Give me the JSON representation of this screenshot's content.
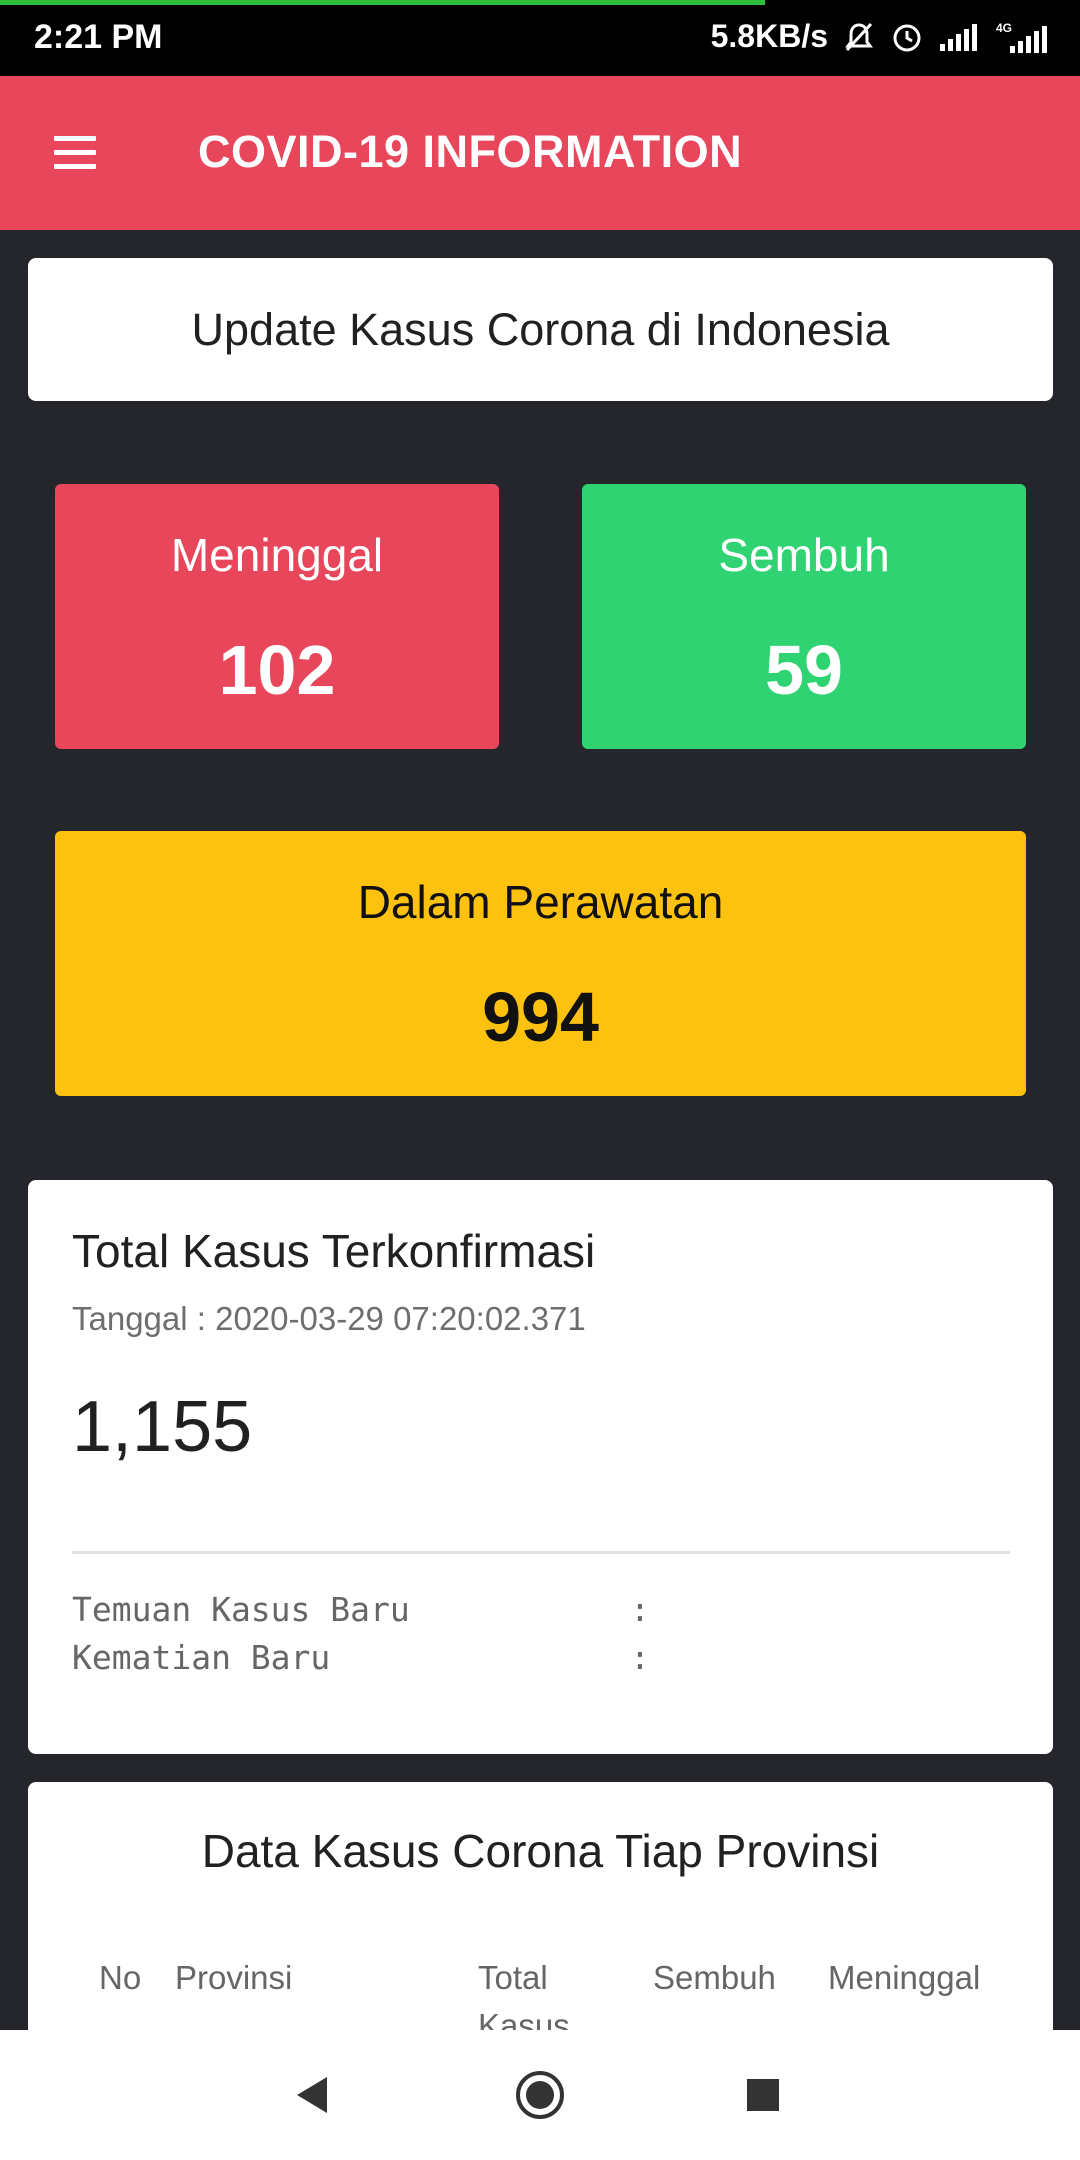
{
  "status_bar": {
    "time": "2:21 PM",
    "net_speed": "5.8KB/s",
    "icons": [
      "mute-notifications-icon",
      "alarm-icon",
      "signal-icon",
      "4g-signal-icon"
    ]
  },
  "app_bar": {
    "title": "COVID-19 INFORMATION",
    "menu_icon": "hamburger-menu-icon",
    "color": "#e8465b"
  },
  "headline": "Update Kasus Corona di Indonesia",
  "stats": {
    "deaths": {
      "label": "Meninggal",
      "value": "102",
      "color": "#e8465b"
    },
    "recovered": {
      "label": "Sembuh",
      "value": "59",
      "color": "#2fd372"
    },
    "in_treatment": {
      "label": "Dalam Perawatan",
      "value": "994",
      "color": "#fdc20f"
    }
  },
  "confirmed": {
    "title": "Total Kasus Terkonfirmasi",
    "date": "Tanggal : 2020-03-29 07:20:02.371",
    "value": "1,155",
    "rows": [
      {
        "label": "Temuan Kasus Baru",
        "sep": ":"
      },
      {
        "label": "Kematian Baru",
        "sep": ":"
      }
    ]
  },
  "province_table": {
    "title": "Data Kasus Corona Tiap Provinsi",
    "headers": [
      "No",
      "Provinsi",
      "Total Kasus",
      "Sembuh",
      "Meninggal"
    ]
  },
  "nav_bar": {
    "icons": [
      "back-icon",
      "home-icon",
      "recents-icon"
    ]
  }
}
